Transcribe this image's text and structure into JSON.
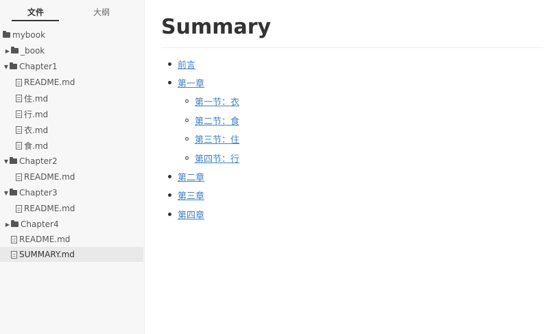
{
  "sidebar": {
    "tabs": [
      {
        "label": "文件",
        "active": true
      },
      {
        "label": "大纲",
        "active": false
      }
    ],
    "tree": [
      {
        "label": "mybook",
        "kind": "folder",
        "caret": ""
      },
      {
        "label": "_book",
        "kind": "folder",
        "caret": "▶"
      },
      {
        "label": "Chapter1",
        "kind": "folder",
        "caret": "▼"
      },
      {
        "label": "README.md",
        "kind": "file"
      },
      {
        "label": "住.md",
        "kind": "file"
      },
      {
        "label": "行.md",
        "kind": "file"
      },
      {
        "label": "衣.md",
        "kind": "file"
      },
      {
        "label": "食.md",
        "kind": "file"
      },
      {
        "label": "Chapter2",
        "kind": "folder",
        "caret": "▼"
      },
      {
        "label": "README.md",
        "kind": "file"
      },
      {
        "label": "Chapter3",
        "kind": "folder",
        "caret": "▼"
      },
      {
        "label": "README.md",
        "kind": "file"
      },
      {
        "label": "Chapter4",
        "kind": "folder",
        "caret": "▶"
      },
      {
        "label": "README.md",
        "kind": "file"
      },
      {
        "label": "SUMMARY.md",
        "kind": "file",
        "selected": true
      }
    ]
  },
  "document": {
    "title": "Summary",
    "toc": [
      {
        "label": "前言"
      },
      {
        "label": "第一章"
      },
      {
        "label": "第一节：衣"
      },
      {
        "label": "第二节：食"
      },
      {
        "label": "第三节：住"
      },
      {
        "label": "第四节：行"
      },
      {
        "label": "第二章"
      },
      {
        "label": "第三章"
      },
      {
        "label": "第四章"
      }
    ]
  }
}
